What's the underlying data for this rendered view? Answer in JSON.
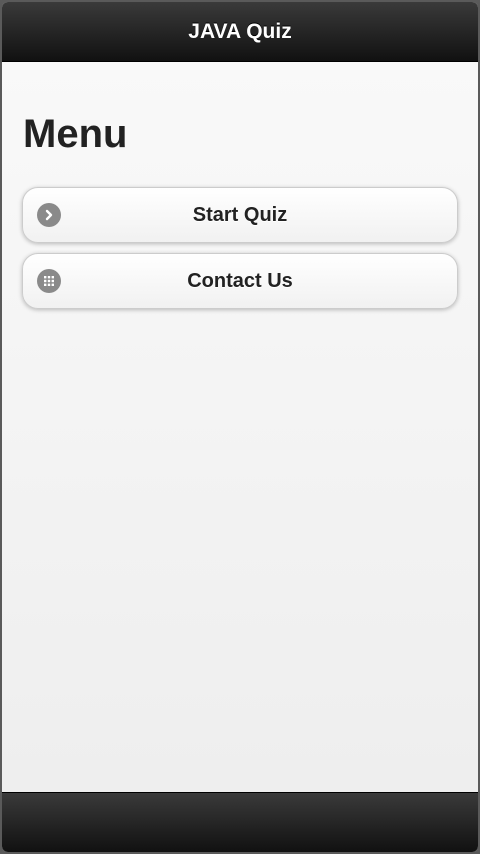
{
  "header": {
    "title": "JAVA Quiz"
  },
  "page": {
    "title": "Menu"
  },
  "menu": {
    "items": [
      {
        "label": "Start Quiz",
        "icon": "arrow-right-icon"
      },
      {
        "label": "Contact Us",
        "icon": "grid-icon"
      }
    ]
  },
  "colors": {
    "bar_background": "#1a1a1a",
    "content_background": "#f0f0f0",
    "icon_color": "#8a8a8a"
  }
}
